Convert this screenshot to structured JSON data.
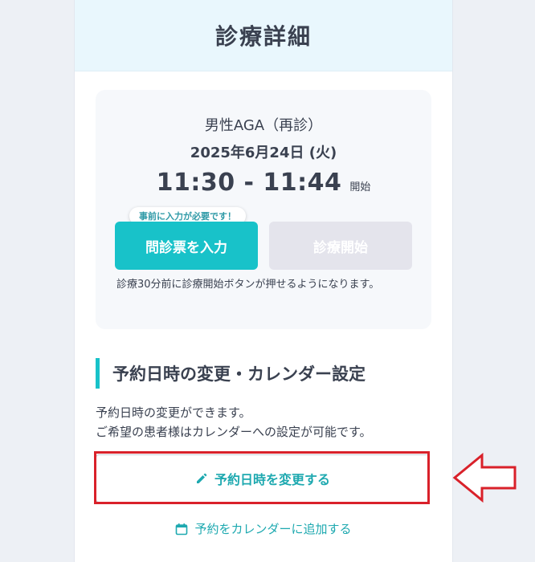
{
  "header": {
    "title": "診療詳細"
  },
  "appointment": {
    "course": "男性AGA（再診）",
    "date": "2025年6月24日 (火)",
    "time": "11:30 - 11:44",
    "time_suffix": "開始",
    "tooltip": "事前に入力が必要です！",
    "questionnaire_button": "問診票を入力",
    "start_button": "診療開始",
    "note": "診療30分前に診療開始ボタンが押せるようになります。"
  },
  "change_section": {
    "heading": "予約日時の変更・カレンダー設定",
    "desc_line1": "予約日時の変更ができます。",
    "desc_line2": "ご希望の患者様はカレンダーへの設定が可能です。",
    "change_button": "予約日時を変更する",
    "calendar_link": "予約をカレンダーに追加する"
  },
  "colors": {
    "accent": "#18c2c9",
    "link": "#1ea9b0",
    "highlight": "#d9212a"
  },
  "icons": [
    "pencil-icon",
    "calendar-icon",
    "arrow-left-icon"
  ]
}
